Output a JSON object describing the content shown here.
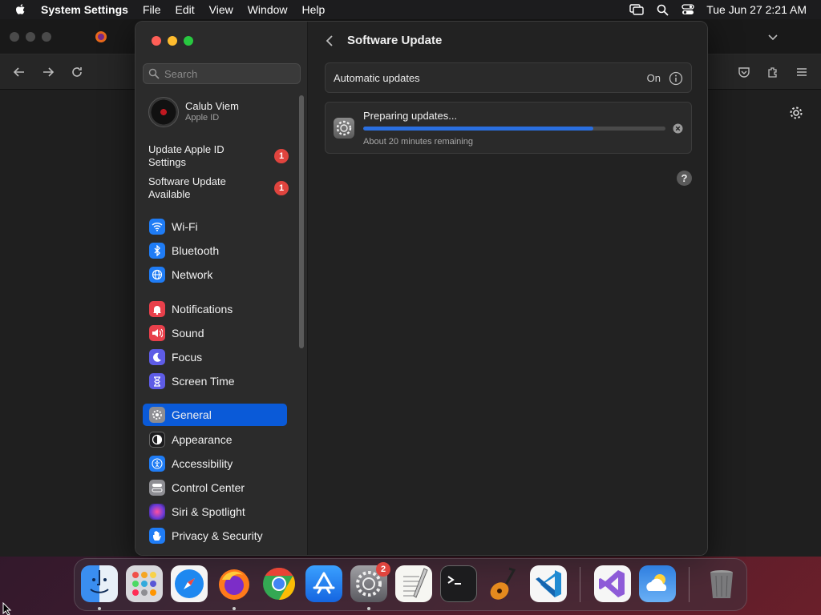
{
  "menubar": {
    "app_name": "System Settings",
    "items": [
      "File",
      "Edit",
      "View",
      "Window",
      "Help"
    ],
    "datetime": "Tue Jun 27  2:21 AM",
    "icons": [
      "screen-mirroring-icon",
      "spotlight-search-icon",
      "control-center-icon"
    ]
  },
  "sidebar": {
    "search_placeholder": "Search",
    "profile": {
      "name": "Calub Viem",
      "subtitle": "Apple ID"
    },
    "alerts": [
      {
        "label": "Update Apple ID Settings",
        "badge": "1"
      },
      {
        "label": "Software Update Available",
        "badge": "1"
      }
    ],
    "items": [
      {
        "label": "Wi-Fi",
        "icon": "wifi-icon",
        "color": "#1f7cf5"
      },
      {
        "label": "Bluetooth",
        "icon": "bluetooth-icon",
        "color": "#1f7cf5"
      },
      {
        "label": "Network",
        "icon": "globe-icon",
        "color": "#1f7cf5"
      },
      {
        "label": "Notifications",
        "icon": "bell-icon",
        "color": "#e8404b"
      },
      {
        "label": "Sound",
        "icon": "speaker-icon",
        "color": "#e8404b"
      },
      {
        "label": "Focus",
        "icon": "moon-icon",
        "color": "#5e5ce6"
      },
      {
        "label": "Screen Time",
        "icon": "hourglass-icon",
        "color": "#5e5ce6"
      },
      {
        "label": "General",
        "icon": "gear-icon",
        "color": "#8e8e93",
        "selected": true
      },
      {
        "label": "Appearance",
        "icon": "appearance-icon",
        "color": "#1c1c1e"
      },
      {
        "label": "Accessibility",
        "icon": "accessibility-icon",
        "color": "#1f7cf5"
      },
      {
        "label": "Control Center",
        "icon": "toggles-icon",
        "color": "#8e8e93"
      },
      {
        "label": "Siri & Spotlight",
        "icon": "siri-icon",
        "color": "#b84fd8"
      },
      {
        "label": "Privacy & Security",
        "icon": "hand-icon",
        "color": "#1f7cf5"
      }
    ]
  },
  "main": {
    "title": "Software Update",
    "automatic_updates": {
      "label": "Automatic updates",
      "status": "On"
    },
    "progress": {
      "title": "Preparing updates...",
      "subtitle": "About 20 minutes remaining",
      "fraction": 0.76
    },
    "help": "?"
  },
  "dock": {
    "apps": [
      "Finder",
      "Launchpad",
      "Safari",
      "Firefox",
      "Google Chrome",
      "App Store",
      "System Settings",
      "TextEdit",
      "Terminal",
      "GarageBand",
      "Visual Studio Code",
      "Visual Studio",
      "Weather",
      "Trash"
    ],
    "system_settings_badge": "2"
  },
  "colors": {
    "accent": "#0a5ad8",
    "badge": "#e0443e",
    "progress": "#2a6fe0"
  }
}
